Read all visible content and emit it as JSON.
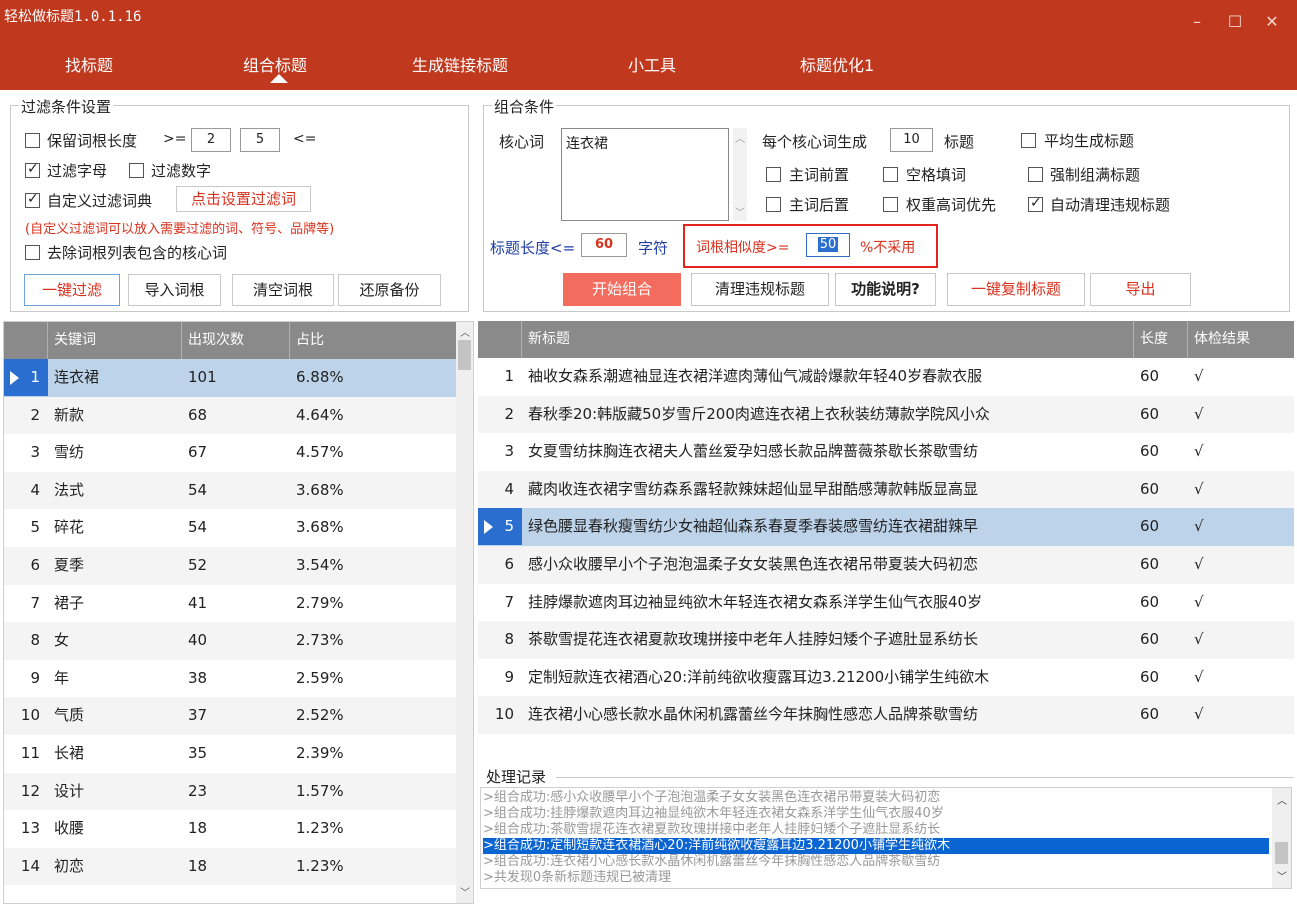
{
  "app": {
    "title": "轻松做标题1.0.1.16",
    "window_controls": [
      "–",
      "☐",
      "✕"
    ]
  },
  "nav": {
    "tabs": [
      "找标题",
      "组合标题",
      "生成链接标题",
      "小工具",
      "标题优化1"
    ],
    "active": 1
  },
  "filter": {
    "legend": "过滤条件设置",
    "keep_root_length_label": "保留词根长度",
    "gte": ">=",
    "min": "2",
    "max": "5",
    "lte": "<=",
    "filter_letters_label": "过滤字母",
    "filter_digits_label": "过滤数字",
    "custom_dict_label": "自定义过滤词典",
    "set_filter_words_button": "点击设置过滤词",
    "hint": "(自定义过滤词可以放入需要过滤的词、符号、品牌等)",
    "remove_core_words_label": "去除词根列表包含的核心词",
    "buttons": {
      "one_click_filter": "一键过滤",
      "import_roots": "导入词根",
      "clear_roots": "清空词根",
      "restore_backup": "还原备份"
    }
  },
  "combo": {
    "legend": "组合条件",
    "core_word_label": "核心词",
    "core_word_value": "连衣裙",
    "per_core_label": "每个核心词生成",
    "per_core_value": "10",
    "titles_unit": "标题",
    "avg_generate_label": "平均生成标题",
    "main_front_label": "主词前置",
    "space_fill_label": "空格填词",
    "force_full_label": "强制组满标题",
    "main_back_label": "主词后置",
    "weight_high_label": "权重高词优先",
    "auto_clean_label": "自动清理违规标题",
    "title_len_label": "标题长度<=",
    "title_len_value": "60",
    "chars_unit": "字符",
    "similarity_label": "词根相似度>=",
    "similarity_value": "50",
    "similarity_suffix": "%不采用",
    "buttons": {
      "start": "开始组合",
      "clean": "清理违规标题",
      "help": "功能说明?",
      "copy": "一键复制标题",
      "export": "导出"
    }
  },
  "keyword_table": {
    "headers": [
      "关键词",
      "出现次数",
      "占比"
    ],
    "rows": [
      {
        "n": "1",
        "kw": "连衣裙",
        "count": "101",
        "pct": "6.88%"
      },
      {
        "n": "2",
        "kw": "新款",
        "count": "68",
        "pct": "4.64%"
      },
      {
        "n": "3",
        "kw": "雪纺",
        "count": "67",
        "pct": "4.57%"
      },
      {
        "n": "4",
        "kw": "法式",
        "count": "54",
        "pct": "3.68%"
      },
      {
        "n": "5",
        "kw": "碎花",
        "count": "54",
        "pct": "3.68%"
      },
      {
        "n": "6",
        "kw": "夏季",
        "count": "52",
        "pct": "3.54%"
      },
      {
        "n": "7",
        "kw": "裙子",
        "count": "41",
        "pct": "2.79%"
      },
      {
        "n": "8",
        "kw": "女",
        "count": "40",
        "pct": "2.73%"
      },
      {
        "n": "9",
        "kw": "年",
        "count": "38",
        "pct": "2.59%"
      },
      {
        "n": "10",
        "kw": "气质",
        "count": "37",
        "pct": "2.52%"
      },
      {
        "n": "11",
        "kw": "长裙",
        "count": "35",
        "pct": "2.39%"
      },
      {
        "n": "12",
        "kw": "设计",
        "count": "23",
        "pct": "1.57%"
      },
      {
        "n": "13",
        "kw": "收腰",
        "count": "18",
        "pct": "1.23%"
      },
      {
        "n": "14",
        "kw": "初恋",
        "count": "18",
        "pct": "1.23%"
      }
    ],
    "selected_row": 0
  },
  "title_table": {
    "headers": [
      "新标题",
      "长度",
      "体检结果"
    ],
    "rows": [
      {
        "n": "1",
        "title": "袖收女森系潮遮袖显连衣裙洋遮肉薄仙气减龄爆款年轻40岁春款衣服",
        "len": "60",
        "check": "√"
      },
      {
        "n": "2",
        "title": "春秋季20:韩版藏50岁雪斤200肉遮连衣裙上衣秋装纺薄款学院风小众",
        "len": "60",
        "check": "√"
      },
      {
        "n": "3",
        "title": "女夏雪纺抹胸连衣裙夫人蕾丝爱孕妇感长款品牌蔷薇茶歇长茶歇雪纺",
        "len": "60",
        "check": "√"
      },
      {
        "n": "4",
        "title": "藏肉收连衣裙字雪纺森系露轻款辣妹超仙显早甜酷感薄款韩版显高显",
        "len": "60",
        "check": "√"
      },
      {
        "n": "5",
        "title": "绿色腰显春秋瘦雪纺少女袖超仙森系春夏季春装感雪纺连衣裙甜辣早",
        "len": "60",
        "check": "√"
      },
      {
        "n": "6",
        "title": "感小众收腰早小个子泡泡温柔子女女装黑色连衣裙吊带夏装大码初恋",
        "len": "60",
        "check": "√"
      },
      {
        "n": "7",
        "title": "挂脖爆款遮肉耳边袖显纯欲木年轻连衣裙女森系洋学生仙气衣服40岁",
        "len": "60",
        "check": "√"
      },
      {
        "n": "8",
        "title": "茶歇雪提花连衣裙夏款玫瑰拼接中老年人挂脖妇矮个子遮肚显系纺长",
        "len": "60",
        "check": "√"
      },
      {
        "n": "9",
        "title": "定制短款连衣裙酒心20:洋前纯欲收瘦露耳边3.21200小铺学生纯欲木",
        "len": "60",
        "check": "√"
      },
      {
        "n": "10",
        "title": "连衣裙小心感长款水晶休闲机露蕾丝今年抹胸性感恋人品牌茶歇雪纺",
        "len": "60",
        "check": "√"
      }
    ],
    "selected_row": 4
  },
  "log": {
    "legend": "处理记录",
    "lines": [
      ">组合成功:感小众收腰早小个子泡泡温柔子女女装黑色连衣裙吊带夏装大码初恋",
      ">组合成功:挂脖爆款遮肉耳边袖显纯欲木年轻连衣裙女森系洋学生仙气衣服40岁",
      ">组合成功:茶歇雪提花连衣裙夏款玫瑰拼接中老年人挂脖妇矮个子遮肚显系纺长",
      ">组合成功:定制短款连衣裙酒心20:洋前纯欲收瘦露耳边3.21200小铺学生纯欲木",
      ">组合成功:连衣裙小心感长款水晶休闲机露蕾丝今年抹胸性感恋人品牌茶歇雪纺",
      ">共发现0条新标题违规已被清理"
    ],
    "selected_line": 3
  },
  "colors": {
    "brand_red": "#c0391f",
    "accent_red": "#d8311e",
    "start_button": "#f36c5e",
    "selection_blue": "#0a64d2",
    "grid_header": "#8a8a8a"
  }
}
